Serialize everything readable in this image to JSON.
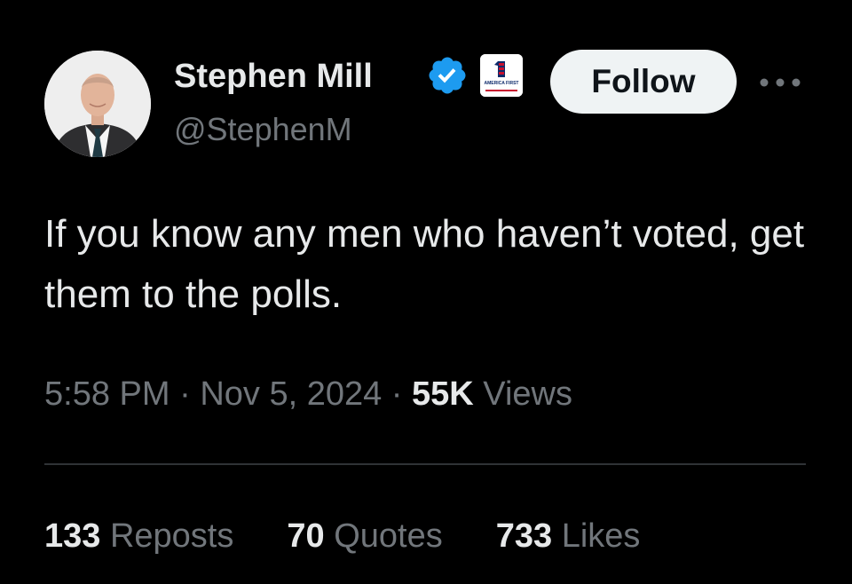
{
  "author": {
    "display_name": "Stephen Mill",
    "handle": "@StephenM",
    "verified_icon": "verified-badge-icon",
    "affiliate_badge_text": "AMERICA FIRST"
  },
  "actions": {
    "follow_label": "Follow",
    "more_icon": "more-icon"
  },
  "tweet": {
    "text": "If you know any men who haven’t voted, get them to the polls."
  },
  "meta": {
    "time": "5:58 PM",
    "sep1": " · ",
    "date": "Nov 5, 2024",
    "sep2": " · ",
    "views_count": "55K",
    "views_label": " Views"
  },
  "stats": {
    "reposts_count": "133",
    "reposts_label": " Reposts",
    "quotes_count": "70",
    "quotes_label": " Quotes",
    "likes_count": "733",
    "likes_label": " Likes"
  },
  "colors": {
    "background": "#000000",
    "primary_text": "#e7e9ea",
    "secondary_text": "#71767b",
    "verified_blue": "#1d9bf0",
    "follow_bg": "#eff3f4",
    "divider": "#2f3336"
  }
}
